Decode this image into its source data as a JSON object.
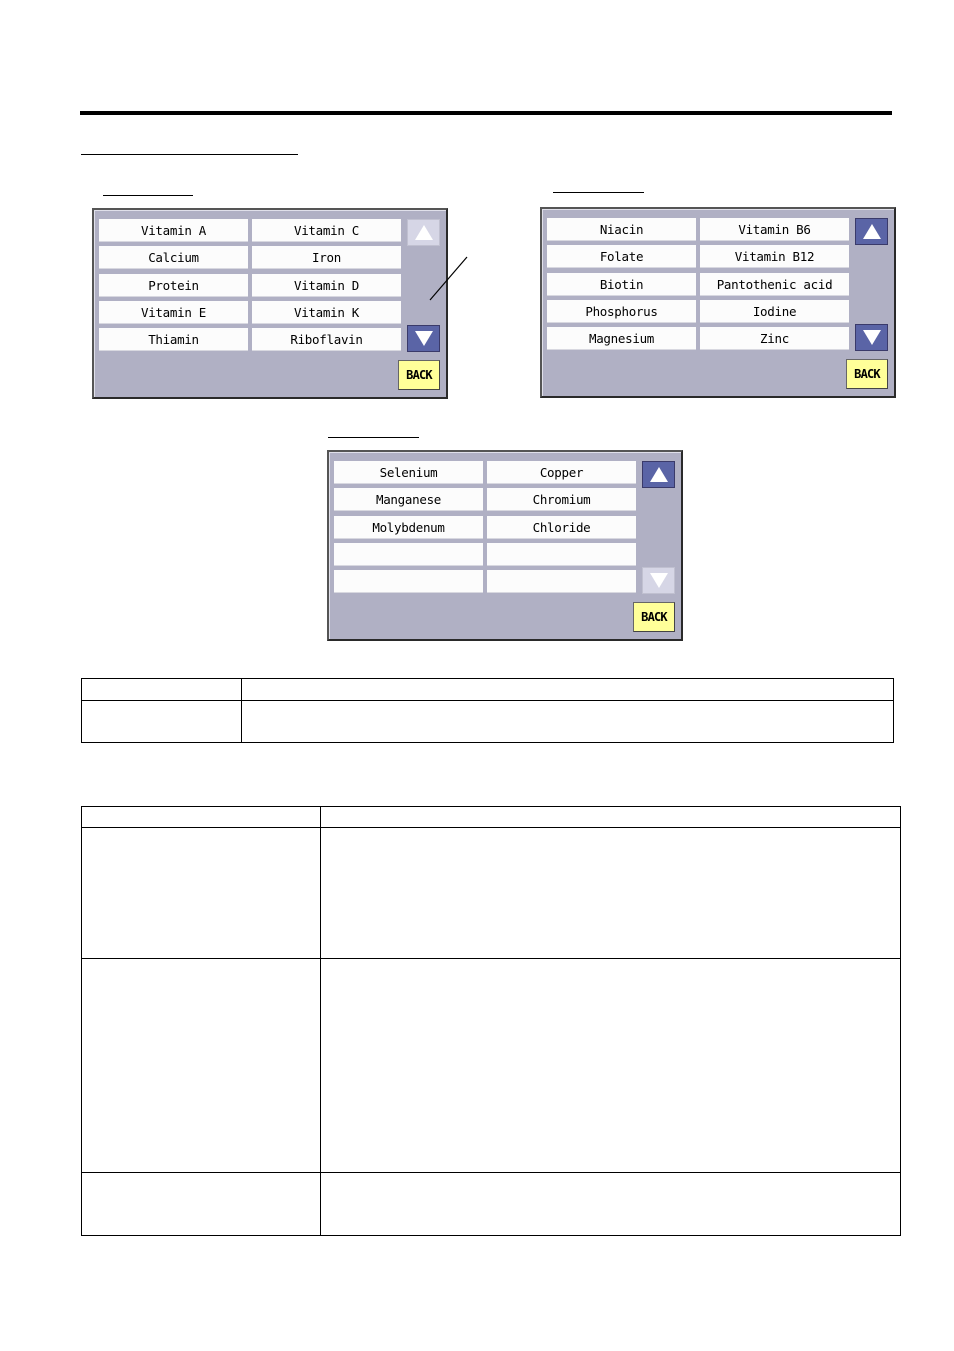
{
  "page": {
    "header_rule": true
  },
  "panels": [
    {
      "id": "page-1",
      "items": [
        "Vitamin A",
        "Vitamin C",
        "Calcium",
        "Iron",
        "Protein",
        "Vitamin D",
        "Vitamin E",
        "Vitamin K",
        "Thiamin",
        "Riboflavin"
      ],
      "scroll_up": {
        "enabled": false
      },
      "scroll_down": {
        "enabled": true
      },
      "back_label": "BACK"
    },
    {
      "id": "page-2",
      "items": [
        "Niacin",
        "Vitamin B6",
        "Folate",
        "Vitamin B12",
        "Biotin",
        "Pantothenic acid",
        "Phosphorus",
        "Iodine",
        "Magnesium",
        "Zinc"
      ],
      "scroll_up": {
        "enabled": true
      },
      "scroll_down": {
        "enabled": true
      },
      "back_label": "BACK"
    },
    {
      "id": "page-3",
      "items": [
        "Selenium",
        "Copper",
        "Manganese",
        "Chromium",
        "Molybdenum",
        "Chloride",
        "",
        "",
        "",
        ""
      ],
      "scroll_up": {
        "enabled": true
      },
      "scroll_down": {
        "enabled": false
      },
      "back_label": "BACK"
    }
  ],
  "colors": {
    "panel_bg": "#b0b0c4",
    "arrow_active": "#5a64a6",
    "arrow_inactive": "#d6d6e6",
    "back_button": "#ffff99"
  },
  "table_1": {
    "rows": [
      [
        "",
        ""
      ],
      [
        "",
        ""
      ]
    ]
  },
  "table_2": {
    "rows": [
      [
        "",
        ""
      ],
      [
        "",
        ""
      ],
      [
        "",
        ""
      ],
      [
        "",
        ""
      ]
    ]
  }
}
